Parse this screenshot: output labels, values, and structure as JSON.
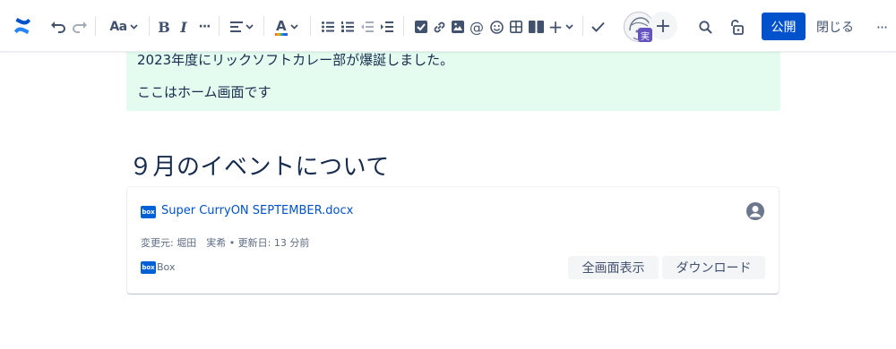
{
  "toolbar": {
    "logo_icon": "confluence-logo-icon",
    "items": [
      {
        "name": "undo-icon"
      },
      {
        "name": "redo-icon"
      },
      {
        "name": "text-style-dropdown",
        "label": "Aa"
      },
      {
        "name": "bold-button",
        "label": "B"
      },
      {
        "name": "italic-button",
        "label": "I"
      },
      {
        "name": "more-formatting-button",
        "label": "···"
      },
      {
        "name": "alignment-dropdown"
      },
      {
        "name": "text-color-dropdown",
        "label": "A"
      },
      {
        "name": "bullet-list-icon"
      },
      {
        "name": "numbered-list-icon"
      },
      {
        "name": "outdent-icon"
      },
      {
        "name": "indent-icon"
      },
      {
        "name": "task-icon"
      },
      {
        "name": "link-icon"
      },
      {
        "name": "image-icon"
      },
      {
        "name": "mention-icon",
        "label": "@"
      },
      {
        "name": "emoji-icon"
      },
      {
        "name": "table-icon"
      },
      {
        "name": "layout-icon"
      },
      {
        "name": "insert-dropdown",
        "label": "+"
      },
      {
        "name": "check-icon"
      }
    ],
    "avatar_badge": "実",
    "invite_label": "+",
    "publish_label": "公開",
    "close_label": "閉じる",
    "more_label": "···"
  },
  "info_panel": {
    "line1": "2023年度にリックソフトカレー部が爆誕しました。",
    "line2": "ここはホーム画面です"
  },
  "heading": "９月のイベントについて",
  "file_card": {
    "file_name": "Super CurryON SEPTEMBER.docx",
    "logo_text": "box",
    "meta": "変更元: 堀田　実希 • 更新日: 13 分前",
    "source_label": "Box",
    "fullscreen_label": "全画面表示",
    "download_label": "ダウンロード"
  },
  "colors": {
    "primary": "#0052cc",
    "info_bg": "#e3fcef",
    "box_blue": "#0061d5",
    "text": "#172b4d"
  }
}
